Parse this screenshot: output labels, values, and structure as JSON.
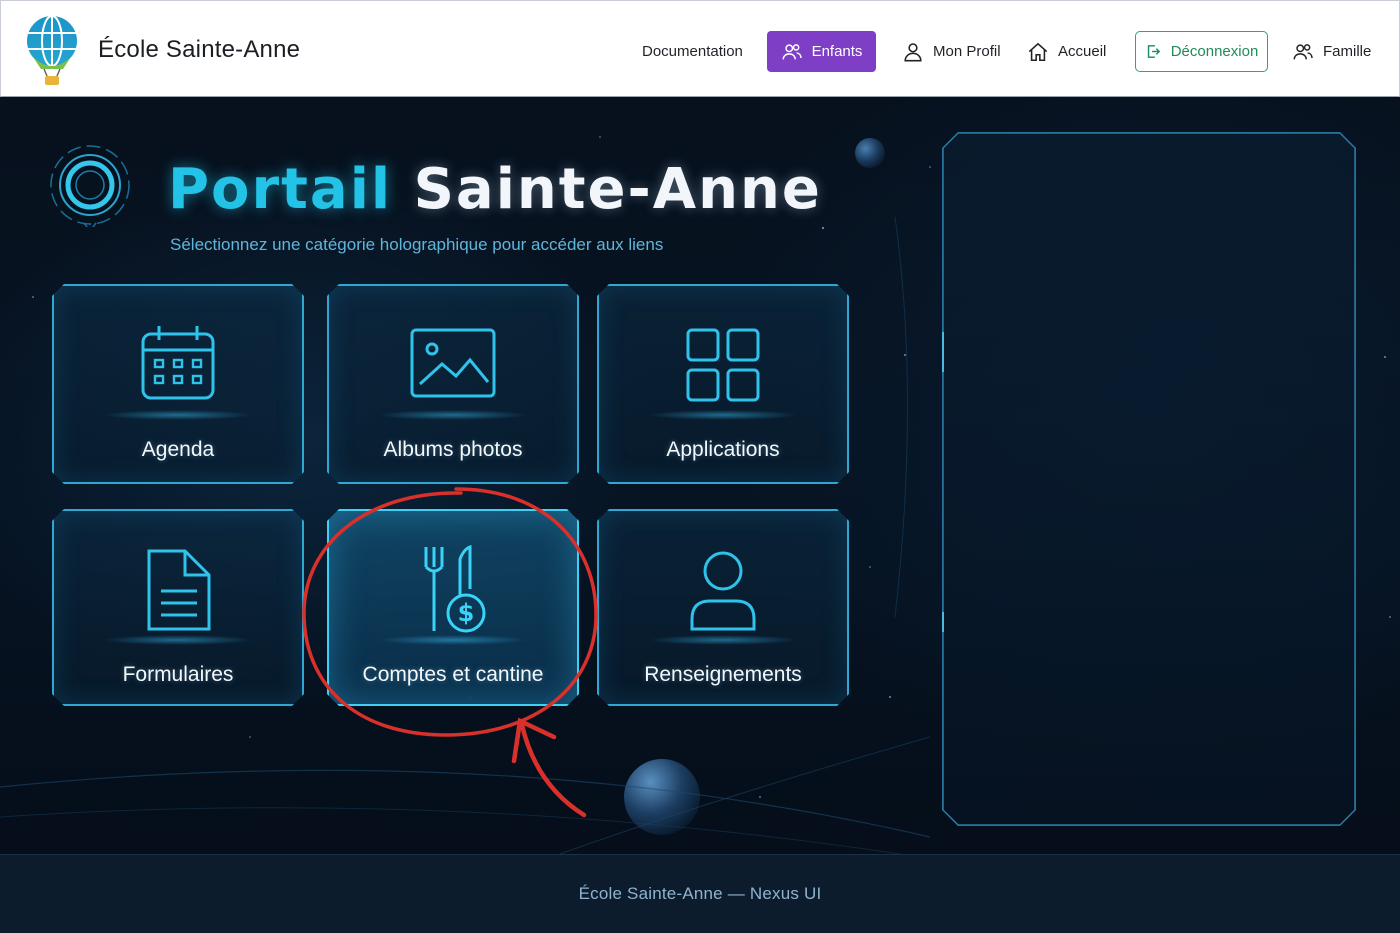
{
  "header": {
    "school_name": "École Sainte-Anne",
    "nav": {
      "documentation": "Documentation",
      "enfants": "Enfants",
      "mon_profil": "Mon Profil",
      "accueil": "Accueil",
      "deconnexion": "Déconnexion",
      "famille": "Famille"
    },
    "active_item": "Enfants",
    "colors": {
      "active_bg": "#7e3fc6",
      "logout_border": "#2fa574"
    }
  },
  "hero": {
    "title_accent": "Portail",
    "title_main": "Sainte-Anne",
    "subtitle": "Sélectionnez une catégorie holographique pour accéder aux liens",
    "accent_color": "#22c3e6"
  },
  "tiles": [
    {
      "label": "Agenda",
      "icon": "calendar-icon"
    },
    {
      "label": "Albums photos",
      "icon": "image-icon"
    },
    {
      "label": "Applications",
      "icon": "grid-icon"
    },
    {
      "label": "Formulaires",
      "icon": "document-icon"
    },
    {
      "label": "Comptes et cantine",
      "icon": "fork-knife-dollar-icon",
      "highlighted": true
    },
    {
      "label": "Renseignements",
      "icon": "user-icon"
    }
  ],
  "side_panel": {
    "state": "empty"
  },
  "annotation": {
    "shape": "red-circle-with-arrow",
    "target": "Comptes et cantine",
    "color": "#d9302b"
  },
  "footer": {
    "text": "École Sainte-Anne — Nexus UI"
  }
}
